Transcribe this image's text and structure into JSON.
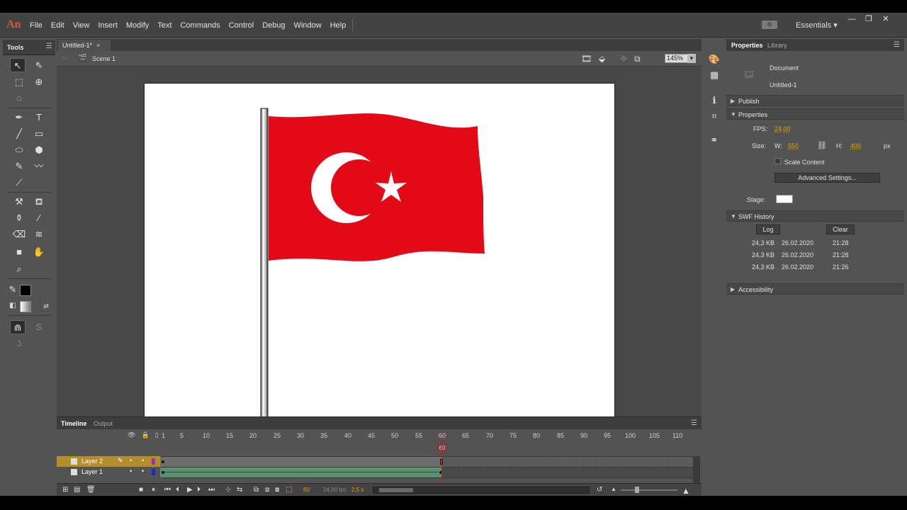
{
  "app": {
    "logo": "An",
    "menus": [
      "File",
      "Edit",
      "View",
      "Insert",
      "Modify",
      "Text",
      "Commands",
      "Control",
      "Debug",
      "Window",
      "Help"
    ],
    "workspace": "Essentials",
    "window_controls": [
      "—",
      "❐",
      "✕"
    ]
  },
  "tools": {
    "title": "Tools",
    "items": [
      "selection-tool",
      "subselection-tool",
      "free-transform-tool",
      "3d-rotation-tool",
      "lasso-tool",
      "pen-tool",
      "text-tool",
      "line-tool",
      "rectangle-tool",
      "oval-tool",
      "polystar-tool",
      "pencil-tool",
      "brush-tool",
      "paint-brush-tool",
      "bone-tool",
      "paint-bucket-tool",
      "ink-bottle-tool",
      "eyedropper-tool",
      "eraser-tool",
      "width-tool",
      "camera-tool",
      "hand-tool",
      "zoom-tool"
    ]
  },
  "document": {
    "tab_title": "Untitled-1*",
    "tab_close": "×",
    "scene_name": "Scene 1",
    "zoom": "145%"
  },
  "timeline": {
    "tabs": [
      "Timeline",
      "Output"
    ],
    "frame_numbers": [
      "1",
      "5",
      "10",
      "15",
      "20",
      "25",
      "30",
      "35",
      "40",
      "45",
      "50",
      "55",
      "60",
      "65",
      "70",
      "75",
      "80",
      "85",
      "90",
      "95",
      "100",
      "105",
      "110"
    ],
    "layers": [
      {
        "name": "Layer 2",
        "color": "#9b30c8",
        "selected": true
      },
      {
        "name": "Layer 1",
        "color": "#1a2ccc",
        "selected": false
      }
    ],
    "current_frame": "60",
    "fps_display": "24,00 fps",
    "time_display": "2,5 s",
    "playhead_label": "60"
  },
  "properties": {
    "tabs": [
      "Properties",
      "Library"
    ],
    "doc_type": "Document",
    "doc_name": "Untitled-1",
    "sections": {
      "publish": "Publish",
      "properties": "Properties",
      "swf_history": "SWF History",
      "accessibility": "Accessibility"
    },
    "fps_label": "FPS:",
    "fps_value": "24,00",
    "size_label": "Size:",
    "w_label": "W:",
    "w_value": "550",
    "h_label": "H:",
    "h_value": "400",
    "unit": "px",
    "scale_content": "Scale Content",
    "advanced_settings": "Advanced Settings...",
    "stage_label": "Stage:",
    "stage_color": "#ffffff",
    "log_button": "Log",
    "clear_button": "Clear",
    "history": [
      {
        "size": "24,3 KB",
        "date": "26.02.2020",
        "time": "21:28"
      },
      {
        "size": "24,3 KB",
        "date": "26.02.2020",
        "time": "21:28"
      },
      {
        "size": "24,3 KB",
        "date": "26.02.2020",
        "time": "21:26"
      }
    ]
  },
  "colors": {
    "flag_red": "#e30a17",
    "flag_white": "#ffffff",
    "accent_orange": "#e0a600",
    "layer_selected": "#b38e2a"
  }
}
